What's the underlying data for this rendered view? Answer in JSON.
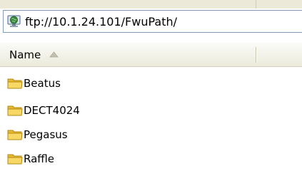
{
  "address_bar": {
    "path": "ftp://10.1.24.101/FwuPath/",
    "icon": "network-globe-icon"
  },
  "columns": {
    "name_label": "Name",
    "sort": "ascending"
  },
  "files": [
    {
      "label": "Beatus",
      "icon": "folder-icon"
    },
    {
      "label": "DECT4024",
      "icon": "folder-icon"
    },
    {
      "label": "Pegasus",
      "icon": "folder-icon"
    },
    {
      "label": "Raffle",
      "icon": "folder-icon"
    }
  ],
  "colors": {
    "folder_fill": "#f5d36a",
    "folder_stroke": "#c79a1e",
    "address_border": "#7f9db9",
    "header_bg": "#ebeadb"
  }
}
